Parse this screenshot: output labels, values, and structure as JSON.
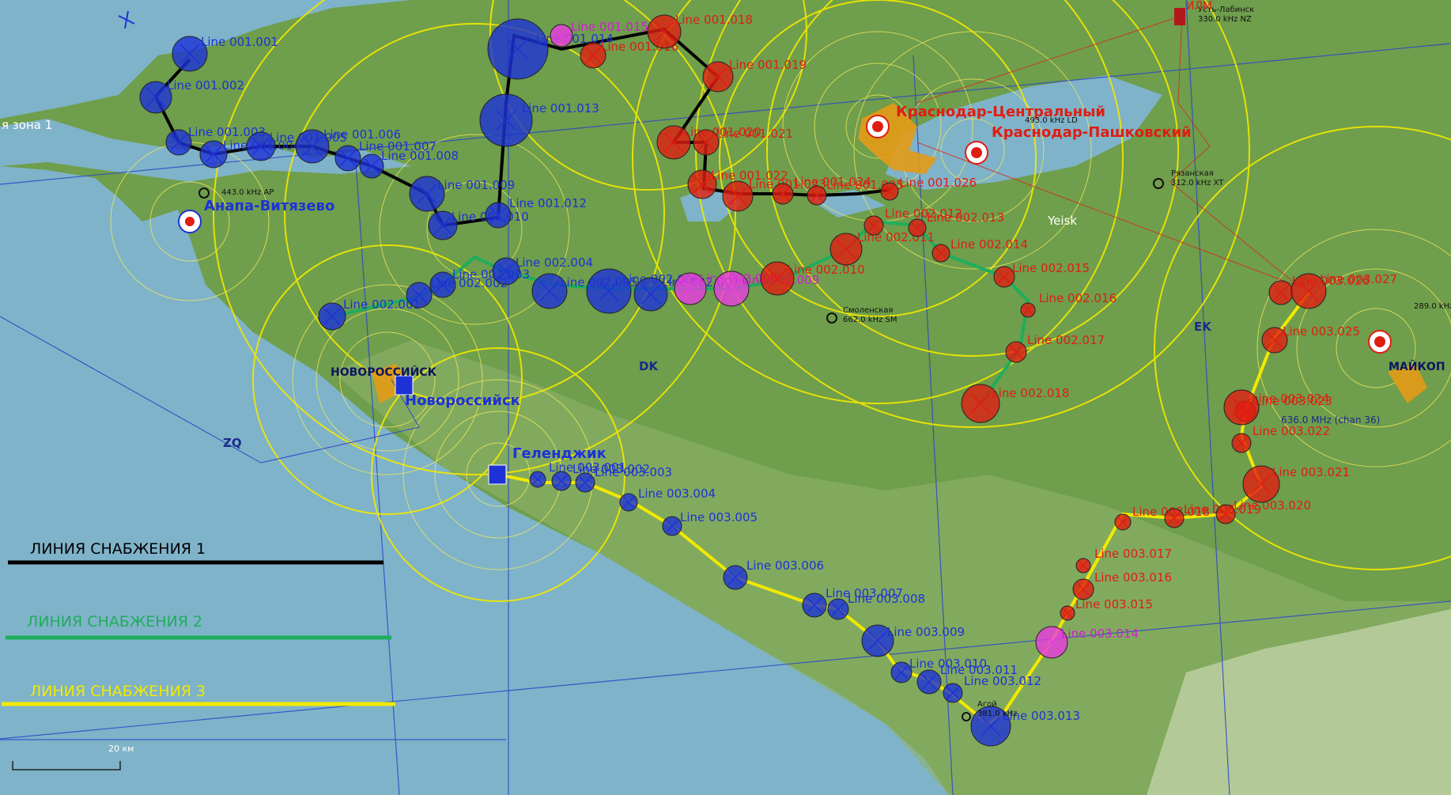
{
  "map": {
    "zone_label": "я зона 1",
    "scale_label": "20 км",
    "grid_labels": [
      "DK",
      "EK",
      "ZQ"
    ],
    "cities": [
      "НОВОРОССИЙСК",
      "МАЙКОП"
    ]
  },
  "legend": [
    {
      "label": "ЛИНИЯ СНАБЖЕНИЯ 1",
      "color": "#000000"
    },
    {
      "label": "ЛИНИЯ СНАБЖЕНИЯ 2",
      "color": "#1fae5b"
    },
    {
      "label": "ЛИНИЯ СНАБЖЕНИЯ 3",
      "color": "#f2e900"
    }
  ],
  "airbases": [
    {
      "name": "Анапа-Витязево",
      "color": "#1d32d6"
    },
    {
      "name": "Новороссийск",
      "color": "#1d32d6"
    },
    {
      "name": "Геленджик",
      "color": "#1d32d6"
    },
    {
      "name": "Краснодар-Центральный",
      "color": "#e01d12"
    },
    {
      "name": "Краснодар-Пашковский",
      "color": "#e01d12"
    }
  ],
  "beacons": [
    {
      "name": "443.0 kHz AP"
    },
    {
      "name": "Смоленская",
      "freq": "662.0 kHz SM"
    },
    {
      "name": "Рязанская",
      "freq": "312.0 kHz XT"
    },
    {
      "name": "Усть-Лабинск",
      "freq": "330.0 kHz NZ"
    },
    {
      "name": "Агой",
      "freq": "381.0 kHz"
    },
    {
      "name": "636.0 MHz (chan 36)"
    },
    {
      "name": "493.0 kHz LD"
    },
    {
      "name": "289.0 kHz"
    },
    {
      "name": "Yeisk"
    },
    {
      "name": "ИЛМ"
    }
  ],
  "supply_lines": [
    {
      "id": "line1",
      "color": "#000000",
      "points": [
        {
          "label": "Line 001.001",
          "side": "blue"
        },
        {
          "label": "Line 001.002",
          "side": "blue"
        },
        {
          "label": "Line 001.003",
          "side": "blue"
        },
        {
          "label": "Line 001.004",
          "side": "blue"
        },
        {
          "label": "Line 001.005",
          "side": "blue"
        },
        {
          "label": "Line 001.006",
          "side": "blue"
        },
        {
          "label": "Line 001.007",
          "side": "blue"
        },
        {
          "label": "Line 001.008",
          "side": "blue"
        },
        {
          "label": "Line 001.009",
          "side": "blue"
        },
        {
          "label": "Line 001.010",
          "side": "blue"
        },
        {
          "label": "Line 001.012",
          "side": "blue"
        },
        {
          "label": "Line 001.013",
          "side": "blue"
        },
        {
          "label": "Line 001.014",
          "side": "blue"
        },
        {
          "label": "Line 001.015",
          "side": "magenta"
        },
        {
          "label": "Line 001.016",
          "side": "red"
        },
        {
          "label": "Line 001.018",
          "side": "red"
        },
        {
          "label": "Line 001.019",
          "side": "red"
        },
        {
          "label": "Line 001.020",
          "side": "red"
        },
        {
          "label": "Line 001.021",
          "side": "red"
        },
        {
          "label": "Line 001.022",
          "side": "red"
        },
        {
          "label": "Line 001.023",
          "side": "red"
        },
        {
          "label": "Line 001.024",
          "side": "red"
        },
        {
          "label": "Line 001.025",
          "side": "red"
        },
        {
          "label": "Line 001.026",
          "side": "red"
        }
      ]
    },
    {
      "id": "line2",
      "color": "#1fae5b",
      "points": [
        {
          "label": "Line 002.001",
          "side": "blue"
        },
        {
          "label": "Line 002.002",
          "side": "blue"
        },
        {
          "label": "Line 002.003",
          "side": "blue"
        },
        {
          "label": "Line 002.004",
          "side": "blue"
        },
        {
          "label": "Line 002.005",
          "side": "blue"
        },
        {
          "label": "Line 002.006",
          "side": "blue"
        },
        {
          "label": "Line 002.007",
          "side": "blue"
        },
        {
          "label": "Line 002.008",
          "side": "magenta"
        },
        {
          "label": "Line 002.009",
          "side": "magenta"
        },
        {
          "label": "Line 002.010",
          "side": "red"
        },
        {
          "label": "Line 002.011",
          "side": "red"
        },
        {
          "label": "Line 002.012",
          "side": "red"
        },
        {
          "label": "Line 002.013",
          "side": "red"
        },
        {
          "label": "Line 002.014",
          "side": "red"
        },
        {
          "label": "Line 002.015",
          "side": "red"
        },
        {
          "label": "Line 002.016",
          "side": "red"
        },
        {
          "label": "Line 002.017",
          "side": "red"
        },
        {
          "label": "Line 002.018",
          "side": "red"
        }
      ]
    },
    {
      "id": "line3",
      "color": "#f2e900",
      "points": [
        {
          "label": "Line 003.001",
          "side": "blue"
        },
        {
          "label": "Line 003.002",
          "side": "blue"
        },
        {
          "label": "Line 003.003",
          "side": "blue"
        },
        {
          "label": "Line 003.004",
          "side": "blue"
        },
        {
          "label": "Line 003.005",
          "side": "blue"
        },
        {
          "label": "Line 003.006",
          "side": "blue"
        },
        {
          "label": "Line 003.007",
          "side": "blue"
        },
        {
          "label": "Line 003.008",
          "side": "blue"
        },
        {
          "label": "Line 003.009",
          "side": "blue"
        },
        {
          "label": "Line 003.010",
          "side": "blue"
        },
        {
          "label": "Line 003.011",
          "side": "blue"
        },
        {
          "label": "Line 003.012",
          "side": "blue"
        },
        {
          "label": "Line 003.013",
          "side": "blue"
        },
        {
          "label": "Line 003.014",
          "side": "magenta"
        },
        {
          "label": "Line 003.015",
          "side": "red"
        },
        {
          "label": "Line 003.016",
          "side": "red"
        },
        {
          "label": "Line 003.017",
          "side": "red"
        },
        {
          "label": "Line 003.018",
          "side": "red"
        },
        {
          "label": "Line 003.019",
          "side": "red"
        },
        {
          "label": "Line 003.020",
          "side": "red"
        },
        {
          "label": "Line 003.021",
          "side": "red"
        },
        {
          "label": "Line 003.022",
          "side": "red"
        },
        {
          "label": "Line 003.023",
          "side": "red"
        },
        {
          "label": "Line 003.024",
          "side": "red"
        },
        {
          "label": "Line 003.025",
          "side": "red"
        },
        {
          "label": "Line 003.026",
          "side": "red"
        },
        {
          "label": "Line 003.027",
          "side": "red"
        }
      ]
    }
  ],
  "colors": {
    "sea": "#7fb3c9",
    "land": "#6f9e4c",
    "blue_side": "#1d32d6",
    "red_side": "#e01d12",
    "contested": "#e83be0",
    "range_rings": "#f2e900"
  }
}
